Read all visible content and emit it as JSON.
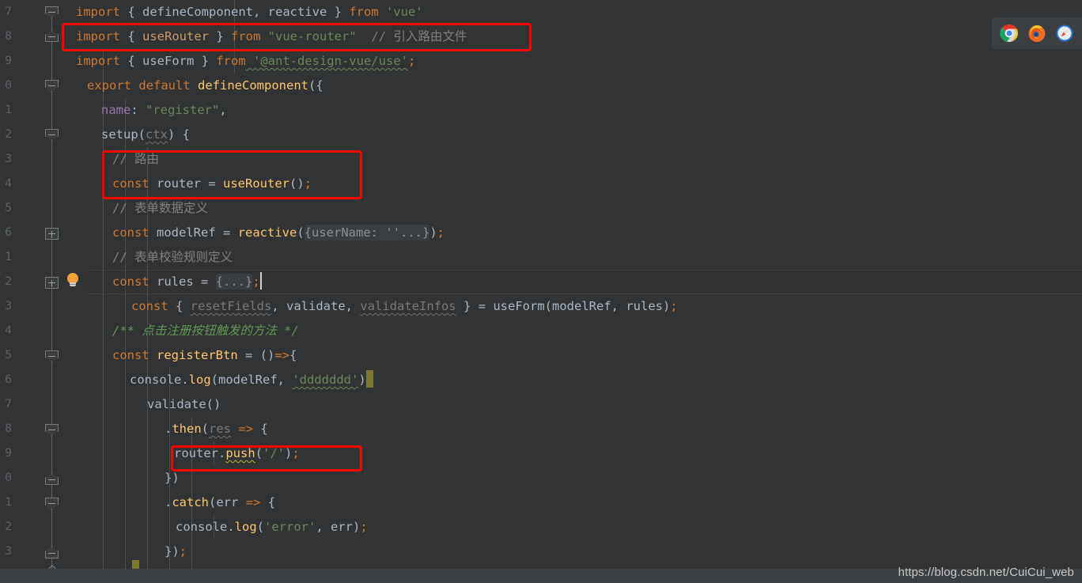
{
  "editor": {
    "theme": "darcula",
    "background": "#313335",
    "gutter_background": "#313335",
    "annotation_color": "#fe0000",
    "line_numbers": [
      "7",
      "8",
      "9",
      "0",
      "1",
      "2",
      "3",
      "4",
      "5",
      "6",
      "1",
      "2",
      "3",
      "4",
      "5",
      "6",
      "7",
      "8",
      "9",
      "0",
      "1",
      "2",
      "3"
    ],
    "lines": [
      {
        "n": "7",
        "tokens": [
          {
            "t": "import",
            "c": "kw"
          },
          {
            "t": " { ",
            "c": "brace"
          },
          {
            "t": "defineComponent",
            "c": "ident"
          },
          {
            "t": ", ",
            "c": "brace"
          },
          {
            "t": "reactive",
            "c": "ident"
          },
          {
            "t": " } ",
            "c": "brace"
          },
          {
            "t": "from",
            "c": "kw"
          },
          {
            "t": " 'vue'",
            "c": "str"
          }
        ]
      },
      {
        "n": "8",
        "tokens": [
          {
            "t": "import",
            "c": "kw"
          },
          {
            "t": " { ",
            "c": "brace"
          },
          {
            "t": "useRouter",
            "c": "useRouter"
          },
          {
            "t": " } ",
            "c": "brace"
          },
          {
            "t": "from",
            "c": "kw"
          },
          {
            "t": " \"vue-router\"",
            "c": "str"
          },
          {
            "t": "  // 引入路由文件",
            "c": "com"
          }
        ]
      },
      {
        "n": "9",
        "tokens": [
          {
            "t": "import",
            "c": "kw"
          },
          {
            "t": " { ",
            "c": "brace"
          },
          {
            "t": "useForm",
            "c": "ident"
          },
          {
            "t": " } ",
            "c": "brace"
          },
          {
            "t": "from",
            "c": "kw"
          },
          {
            "t": " '@ant-design-vue/use'",
            "c": "str sq"
          },
          {
            "t": ";",
            "c": "orange"
          }
        ]
      },
      {
        "n": "0",
        "tokens": [
          {
            "t": "export",
            "c": "kw"
          },
          {
            "t": " ",
            "c": "brace"
          },
          {
            "t": "default",
            "c": "kw"
          },
          {
            "t": " ",
            "c": "brace"
          },
          {
            "t": "defineComponent",
            "c": "fn"
          },
          {
            "t": "({",
            "c": "brace"
          }
        ]
      },
      {
        "n": "1",
        "tokens": [
          {
            "t": "name",
            "c": "prop"
          },
          {
            "t": ": ",
            "c": "brace"
          },
          {
            "t": "\"register\"",
            "c": "str"
          },
          {
            "t": ",",
            "c": "brace"
          }
        ]
      },
      {
        "n": "2",
        "tokens": [
          {
            "t": "setup",
            "c": "ident"
          },
          {
            "t": "(",
            "c": "brace"
          },
          {
            "t": "ctx",
            "c": "dim sqg"
          },
          {
            "t": ") {",
            "c": "brace"
          }
        ]
      },
      {
        "n": "3",
        "tokens": [
          {
            "t": "// 路由",
            "c": "com"
          }
        ]
      },
      {
        "n": "4",
        "tokens": [
          {
            "t": "const",
            "c": "kw"
          },
          {
            "t": " router ",
            "c": "ident"
          },
          {
            "t": "=",
            "c": "brace"
          },
          {
            "t": " ",
            "c": "ident"
          },
          {
            "t": "useRouter",
            "c": "fn"
          },
          {
            "t": "()",
            "c": "brace"
          },
          {
            "t": ";",
            "c": "orange"
          }
        ]
      },
      {
        "n": "5",
        "tokens": [
          {
            "t": "// 表单数据定义",
            "c": "com"
          }
        ]
      },
      {
        "n": "6",
        "tokens": [
          {
            "t": "const",
            "c": "kw"
          },
          {
            "t": " modelRef ",
            "c": "ident"
          },
          {
            "t": "=",
            "c": "brace"
          },
          {
            "t": " ",
            "c": "ident"
          },
          {
            "t": "reactive",
            "c": "fn"
          },
          {
            "t": "(",
            "c": "brace"
          },
          {
            "t": "{userName: ''...}",
            "c": "fold"
          },
          {
            "t": ")",
            "c": "brace"
          },
          {
            "t": ";",
            "c": "orange"
          }
        ]
      },
      {
        "n": "1",
        "tokens": [
          {
            "t": "// 表单校验规则定义",
            "c": "com"
          }
        ]
      },
      {
        "n": "2",
        "tokens": [
          {
            "t": "const",
            "c": "kw"
          },
          {
            "t": " rules ",
            "c": "ident"
          },
          {
            "t": "=",
            "c": "brace"
          },
          {
            "t": " ",
            "c": "ident"
          },
          {
            "t": "{...}",
            "c": "fold"
          },
          {
            "t": ";",
            "c": "orange"
          }
        ]
      },
      {
        "n": "3",
        "tokens": [
          {
            "t": "const",
            "c": "kw"
          },
          {
            "t": " { ",
            "c": "brace"
          },
          {
            "t": "resetFields",
            "c": "dim sqg"
          },
          {
            "t": ", ",
            "c": "brace"
          },
          {
            "t": "validate",
            "c": "ident"
          },
          {
            "t": ", ",
            "c": "brace"
          },
          {
            "t": "validateInfos",
            "c": "dim sqg"
          },
          {
            "t": " } ",
            "c": "brace"
          },
          {
            "t": "=",
            "c": "brace"
          },
          {
            "t": " ",
            "c": "ident"
          },
          {
            "t": "useForm",
            "c": "ident"
          },
          {
            "t": "(modelRef, rules)",
            "c": "brace"
          },
          {
            "t": ";",
            "c": "orange"
          }
        ]
      },
      {
        "n": "4",
        "tokens": [
          {
            "t": "/** 点击注册按钮触发的方法 */",
            "c": "doc"
          }
        ]
      },
      {
        "n": "5",
        "tokens": [
          {
            "t": "const",
            "c": "kw"
          },
          {
            "t": " registerBtn ",
            "c": "fn"
          },
          {
            "t": "=",
            "c": "brace"
          },
          {
            "t": " ()",
            "c": "brace"
          },
          {
            "t": "=>",
            "c": "orange"
          },
          {
            "t": "{",
            "c": "brace"
          }
        ]
      },
      {
        "n": "6",
        "tokens": [
          {
            "t": "console",
            "c": "ident"
          },
          {
            "t": ".",
            "c": "brace"
          },
          {
            "t": "log",
            "c": "fn"
          },
          {
            "t": "(modelRef, ",
            "c": "brace"
          },
          {
            "t": "'ddddddd'",
            "c": "str sq"
          },
          {
            "t": ")",
            "c": "brace"
          }
        ]
      },
      {
        "n": "7",
        "tokens": [
          {
            "t": "validate",
            "c": "ident"
          },
          {
            "t": "()",
            "c": "brace"
          }
        ]
      },
      {
        "n": "8",
        "tokens": [
          {
            "t": ".",
            "c": "brace"
          },
          {
            "t": "then",
            "c": "fn"
          },
          {
            "t": "(",
            "c": "brace"
          },
          {
            "t": "res",
            "c": "dim sqg"
          },
          {
            "t": " ",
            "c": "brace"
          },
          {
            "t": "=>",
            "c": "orange"
          },
          {
            "t": " {",
            "c": "brace"
          }
        ]
      },
      {
        "n": "9",
        "tokens": [
          {
            "t": "router",
            "c": "ident"
          },
          {
            "t": ".",
            "c": "brace"
          },
          {
            "t": "push",
            "c": "fn sqy"
          },
          {
            "t": "(",
            "c": "brace"
          },
          {
            "t": "'/'",
            "c": "str"
          },
          {
            "t": ")",
            "c": "brace"
          },
          {
            "t": ";",
            "c": "orange"
          }
        ]
      },
      {
        "n": "0",
        "tokens": [
          {
            "t": "})",
            "c": "brace"
          }
        ]
      },
      {
        "n": "1",
        "tokens": [
          {
            "t": ".",
            "c": "brace"
          },
          {
            "t": "catch",
            "c": "fn"
          },
          {
            "t": "(err ",
            "c": "brace"
          },
          {
            "t": "=>",
            "c": "orange"
          },
          {
            "t": " {",
            "c": "brace"
          }
        ]
      },
      {
        "n": "2",
        "tokens": [
          {
            "t": "console",
            "c": "ident"
          },
          {
            "t": ".",
            "c": "brace"
          },
          {
            "t": "log",
            "c": "fn"
          },
          {
            "t": "(",
            "c": "brace"
          },
          {
            "t": "'error'",
            "c": "str"
          },
          {
            "t": ", err)",
            "c": "brace"
          },
          {
            "t": ";",
            "c": "orange"
          }
        ]
      },
      {
        "n": "3",
        "tokens": [
          {
            "t": "})",
            "c": "brace"
          },
          {
            "t": ";",
            "c": "orange"
          }
        ]
      }
    ],
    "annotations": [
      {
        "label": "import-userouter-highlight"
      },
      {
        "label": "const-router-highlight"
      },
      {
        "label": "router-push-highlight"
      }
    ]
  },
  "dock": {
    "icons": [
      {
        "name": "chrome-icon",
        "title": "Chrome"
      },
      {
        "name": "firefox-icon",
        "title": "Firefox"
      },
      {
        "name": "safari-icon",
        "title": "Safari"
      }
    ]
  },
  "watermark": {
    "text": "https://blog.csdn.net/CuiCui_web"
  }
}
